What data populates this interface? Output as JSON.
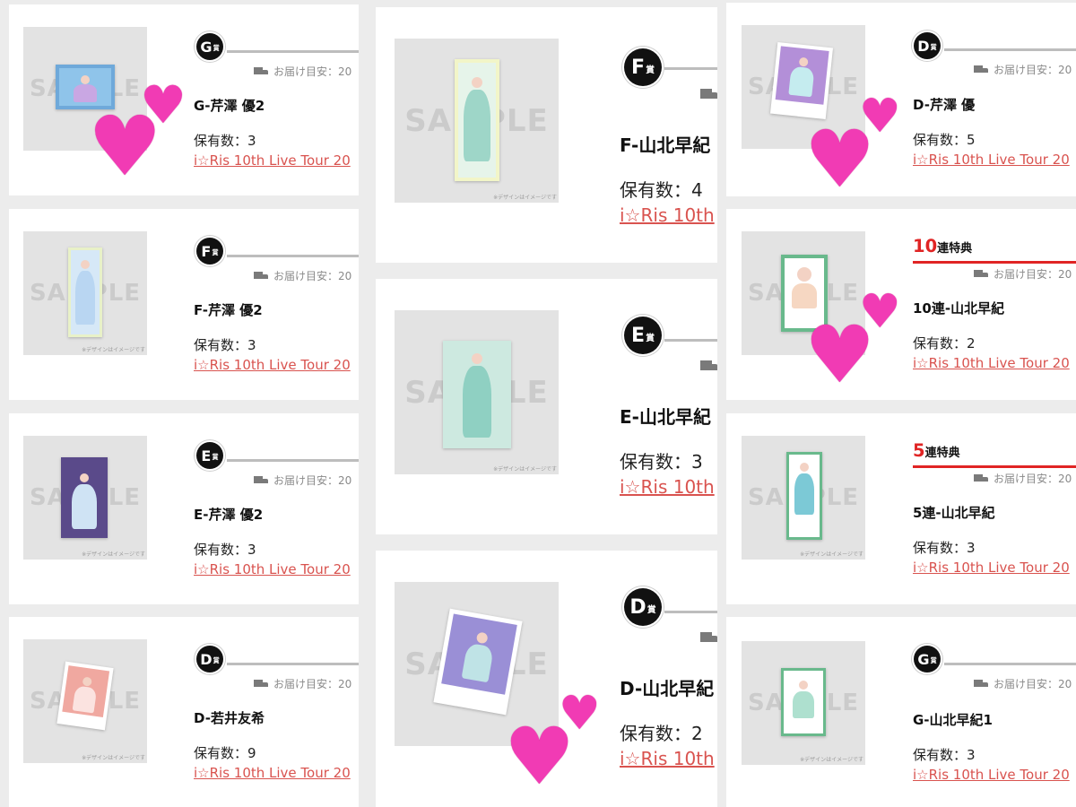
{
  "thumbnail": {
    "sample_text": "SAMPLE",
    "note": "※デザインはイメージです"
  },
  "delivery_label": "お届け目安：20",
  "count_prefix": "保有数：",
  "colors": {
    "accent_red": "#e02424",
    "heart_pink": "#f13bb4",
    "badge": "#111111"
  },
  "left_column": [
    {
      "grade": "G",
      "grade_suffix": "賞",
      "name": "G-芹澤 優2",
      "count": "保有数：3",
      "link": "i☆Ris 10th Live Tour 20"
    },
    {
      "grade": "F",
      "grade_suffix": "賞",
      "name": "F-芹澤 優2",
      "count": "保有数：3",
      "link": "i☆Ris 10th Live Tour 20"
    },
    {
      "grade": "E",
      "grade_suffix": "賞",
      "name": "E-芹澤 優2",
      "count": "保有数：3",
      "link": "i☆Ris 10th Live Tour 20"
    },
    {
      "grade": "D",
      "grade_suffix": "賞",
      "name": "D-若井友希",
      "count": "保有数：9",
      "link": "i☆Ris 10th Live Tour 20"
    }
  ],
  "middle_column": [
    {
      "grade": "F",
      "grade_suffix": "賞",
      "name": "F-山北早紀",
      "count": "保有数：4",
      "link": "i☆Ris 10th"
    },
    {
      "grade": "E",
      "grade_suffix": "賞",
      "name": "E-山北早紀",
      "count": "保有数：3",
      "link": "i☆Ris 10th"
    },
    {
      "grade": "D",
      "grade_suffix": "賞",
      "name": "D-山北早紀",
      "count": "保有数：2",
      "link": "i☆Ris 10th"
    }
  ],
  "right_column": [
    {
      "grade": "D",
      "grade_suffix": "賞",
      "name": "D-芹澤 優",
      "count": "保有数：5",
      "link": "i☆Ris 10th Live Tour 20"
    },
    {
      "bonus_num": "10",
      "bonus_text": "連特典",
      "name": "10連-山北早紀",
      "count": "保有数：2",
      "link": "i☆Ris 10th Live Tour 20"
    },
    {
      "bonus_num": "5",
      "bonus_text": "連特典",
      "name": "5連-山北早紀",
      "count": "保有数：3",
      "link": "i☆Ris 10th Live Tour 20"
    },
    {
      "grade": "G",
      "grade_suffix": "賞",
      "name": "G-山北早紀1",
      "count": "保有数：3",
      "link": "i☆Ris 10th Live Tour 20"
    }
  ],
  "hearts": [
    "♥",
    "♥",
    "♥",
    "♥",
    "♥",
    "♥",
    "♥",
    "♥"
  ]
}
